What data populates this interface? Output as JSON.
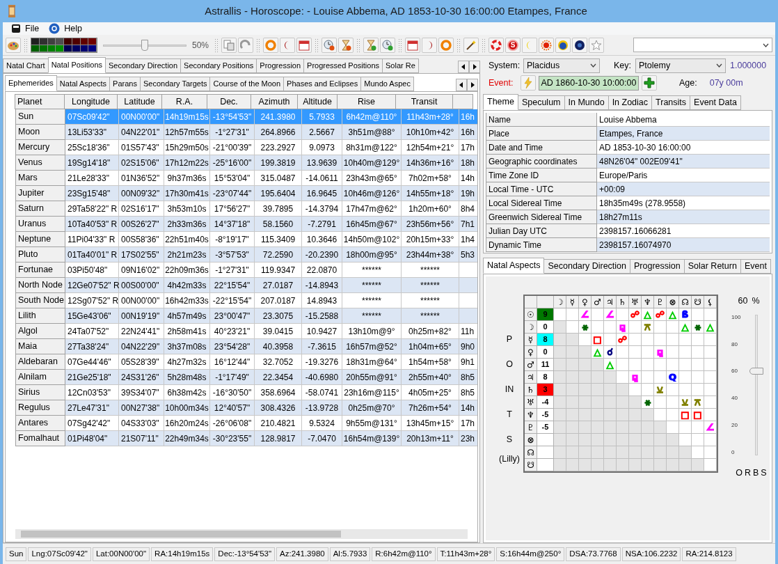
{
  "window": {
    "title": "Astrallis - Horoscope: - Louise Abbema, AD 1853-10-30 16:00:00 Etampes, France"
  },
  "menu": [
    "File",
    "Help"
  ],
  "toolbar": {
    "zoom": {
      "level": 0.5,
      "reading": "50%"
    },
    "badge_letter": "S"
  },
  "left": {
    "tabs": [
      {
        "label": "Natal Chart",
        "selected": false
      },
      {
        "label": "Natal Positions",
        "selected": true
      },
      {
        "label": "Secondary Direction",
        "selected": false
      },
      {
        "label": "Secondary Positions",
        "selected": false
      },
      {
        "label": "Progression",
        "selected": false
      },
      {
        "label": "Progressed Positions",
        "selected": false
      },
      {
        "label": "Solar Re",
        "selected": false
      }
    ],
    "subtabs": [
      {
        "label": "Ephemerides",
        "selected": true
      },
      {
        "label": "Natal Aspects",
        "selected": false
      },
      {
        "label": "Parans",
        "selected": false
      },
      {
        "label": "Secondary Targets",
        "selected": false
      },
      {
        "label": "Course of the Moon",
        "selected": false
      },
      {
        "label": "Phases and Eclipses",
        "selected": false
      },
      {
        "label": "Mundo Aspec",
        "selected": false
      }
    ],
    "table": {
      "columns": [
        "Planet",
        "Longitude",
        "Latitude",
        "R.A.",
        "Dec.",
        "Azimuth",
        "Altitude",
        "Rise",
        "Transit"
      ],
      "rows": [
        {
          "planet": "Sun",
          "selected": true,
          "values": [
            "07Sc09'42\"",
            "00N00'00\"",
            "14h19m15s",
            "-13°54'53\"",
            "241.3980",
            "5.7933",
            "6h42m@110°",
            "11h43m+28°"
          ],
          "column_10": "16h"
        },
        {
          "planet": "Moon",
          "selected": false,
          "values": [
            "13Li53'33\"",
            "04N22'01\"",
            "12h57m55s",
            "-1°27'31\"",
            "264.8966",
            "2.5667",
            "3h51m@88°",
            "10h10m+42°"
          ],
          "column_10": "16h"
        },
        {
          "planet": "Mercury",
          "selected": false,
          "values": [
            "25Sc18'36\"",
            "01S57'43\"",
            "15h29m50s",
            "-21°00'39\"",
            "223.2927",
            "9.0973",
            "8h31m@122°",
            "12h54m+21°"
          ],
          "column_10": "17h"
        },
        {
          "planet": "Venus",
          "selected": false,
          "values": [
            "19Sg14'18\"",
            "02S15'06\"",
            "17h12m22s",
            "-25°16'00\"",
            "199.3819",
            "13.9639",
            "10h40m@129°",
            "14h36m+16°"
          ],
          "column_10": "18h"
        },
        {
          "planet": "Mars",
          "selected": false,
          "values": [
            "21Le28'33\"",
            "01N36'52\"",
            "9h37m36s",
            "15°53'04\"",
            "315.0487",
            "-14.0611",
            "23h43m@65°",
            "7h02m+58°"
          ],
          "column_10": "14h"
        },
        {
          "planet": "Jupiter",
          "selected": false,
          "values": [
            "23Sg15'48\"",
            "00N09'32\"",
            "17h30m41s",
            "-23°07'44\"",
            "195.6404",
            "16.9645",
            "10h46m@126°",
            "14h55m+18°"
          ],
          "column_10": "19h"
        },
        {
          "planet": "Saturn",
          "selected": false,
          "values": [
            "29Ta58'22\" R",
            "02S16'17\"",
            "3h53m10s",
            "17°56'27\"",
            "39.7895",
            "-14.3794",
            "17h47m@62°",
            "1h20m+60°"
          ],
          "column_10": "8h4"
        },
        {
          "planet": "Uranus",
          "selected": false,
          "values": [
            "10Ta40'53\" R",
            "00S26'27\"",
            "2h33m36s",
            "14°37'18\"",
            "58.1560",
            "-7.2791",
            "16h45m@67°",
            "23h56m+56°"
          ],
          "column_10": "7h1"
        },
        {
          "planet": "Neptune",
          "selected": false,
          "values": [
            "11Pi04'33\" R",
            "00S58'36\"",
            "22h51m40s",
            "-8°19'17\"",
            "115.3409",
            "10.3646",
            "14h50m@102°",
            "20h15m+33°"
          ],
          "column_10": "1h4"
        },
        {
          "planet": "Pluto",
          "selected": false,
          "values": [
            "01Ta40'01\" R",
            "17S02'55\"",
            "2h21m23s",
            "-3°57'53\"",
            "72.2590",
            "-20.2390",
            "18h00m@95°",
            "23h44m+38°"
          ],
          "column_10": "5h3"
        },
        {
          "planet": "Fortunae",
          "selected": false,
          "values": [
            "03Pi50'48\"",
            "09N16'02\"",
            "22h09m36s",
            "-1°27'31\"",
            "119.9347",
            "22.0870",
            "******",
            "******"
          ]
        },
        {
          "planet": "North Node",
          "selected": false,
          "values": [
            "12Ge07'52\" R",
            "00S00'00\"",
            "4h42m33s",
            "22°15'54\"",
            "27.0187",
            "-14.8943",
            "******",
            "******"
          ]
        },
        {
          "planet": "South Node",
          "selected": false,
          "values": [
            "12Sg07'52\" R",
            "00N00'00\"",
            "16h42m33s",
            "-22°15'54\"",
            "207.0187",
            "14.8943",
            "******",
            "******"
          ]
        },
        {
          "planet": "Lilith",
          "selected": false,
          "values": [
            "15Ge43'06\"",
            "00N19'19\"",
            "4h57m49s",
            "23°00'47\"",
            "23.3075",
            "-15.2588",
            "******",
            "******"
          ]
        },
        {
          "planet": "Algol",
          "selected": false,
          "values": [
            "24Ta07'52\"",
            "22N24'41\"",
            "2h58m41s",
            "40°23'21\"",
            "39.0415",
            "10.9427",
            "13h10m@9°",
            "0h25m+82°"
          ],
          "column_10": "11h"
        },
        {
          "planet": "Maia",
          "selected": false,
          "values": [
            "27Ta38'24\"",
            "04N22'29\"",
            "3h37m08s",
            "23°54'28\"",
            "40.3958",
            "-7.3615",
            "16h57m@52°",
            "1h04m+65°"
          ],
          "column_10": "9h0"
        },
        {
          "planet": "Aldebaran",
          "selected": false,
          "values": [
            "07Ge44'46\"",
            "05S28'39\"",
            "4h27m32s",
            "16°12'44\"",
            "32.7052",
            "-19.3276",
            "18h31m@64°",
            "1h54m+58°"
          ],
          "column_10": "9h1"
        },
        {
          "planet": "Alnilam",
          "selected": false,
          "values": [
            "21Ge25'18\"",
            "24S31'26\"",
            "5h28m48s",
            "-1°17'49\"",
            "22.3454",
            "-40.6980",
            "20h55m@91°",
            "2h55m+40°"
          ],
          "column_10": "8h5"
        },
        {
          "planet": "Sirius",
          "selected": false,
          "values": [
            "12Cn03'53\"",
            "39S34'07\"",
            "6h38m42s",
            "-16°30'50\"",
            "358.6964",
            "-58.0741",
            "23h16m@115°",
            "4h05m+25°"
          ],
          "column_10": "8h5"
        },
        {
          "planet": "Regulus",
          "selected": false,
          "values": [
            "27Le47'31\"",
            "00N27'38\"",
            "10h00m34s",
            "12°40'57\"",
            "308.4326",
            "-13.9728",
            "0h25m@70°",
            "7h26m+54°"
          ],
          "column_10": "14h"
        },
        {
          "planet": "Antares",
          "selected": false,
          "values": [
            "07Sg42'42\"",
            "04S33'03\"",
            "16h20m24s",
            "-26°06'08\"",
            "210.4821",
            "9.5324",
            "9h55m@131°",
            "13h45m+15°"
          ],
          "column_10": "17h"
        },
        {
          "planet": "Fomalhaut",
          "selected": false,
          "values": [
            "01Pi48'04\"",
            "21S07'11\"",
            "22h49m34s",
            "-30°23'55\"",
            "128.9817",
            "-7.0470",
            "16h54m@139°",
            "20h13m+11°"
          ],
          "column_10": "23h"
        }
      ]
    }
  },
  "right": {
    "system": {
      "label": "System:",
      "value": "Placidus"
    },
    "key": {
      "label": "Key:",
      "value": "Ptolemy",
      "reading": "1.000000"
    },
    "event": {
      "label": "Event:",
      "value": "AD 1860-10-30 10:00:00"
    },
    "age": {
      "label": "Age:",
      "value": "07y 00m"
    },
    "tabs": [
      {
        "label": "Theme",
        "selected": true
      },
      {
        "label": "Speculum",
        "selected": false
      },
      {
        "label": "In Mundo",
        "selected": false
      },
      {
        "label": "In Zodiac",
        "selected": false
      },
      {
        "label": "Transits",
        "selected": false
      },
      {
        "label": "Event Data",
        "selected": false
      }
    ],
    "theme": [
      {
        "label": "Name",
        "value": "Louise Abbema"
      },
      {
        "label": "Place",
        "value": "Etampes, France"
      },
      {
        "label": "Date and Time",
        "value": "AD 1853-10-30 16:00:00"
      },
      {
        "label": "Geographic coordinates",
        "value": "48N26'04\" 002E09'41\""
      },
      {
        "label": "Time Zone ID",
        "value": "Europe/Paris"
      },
      {
        "label": "Local Time - UTC",
        "value": "+00:09"
      },
      {
        "label": "Local Sidereal Time",
        "value": "18h35m49s (278.9558)"
      },
      {
        "label": "Greenwich Sidereal Time",
        "value": "18h27m11s"
      },
      {
        "label": "Julian Day UTC",
        "value": "2398157.16066281"
      },
      {
        "label": "Dynamic Time",
        "value": "2398157.16074970"
      }
    ],
    "bottom_tabs": [
      {
        "label": "Natal Aspects",
        "selected": true
      },
      {
        "label": "Secondary Direction",
        "selected": false
      },
      {
        "label": "Progression",
        "selected": false
      },
      {
        "label": "Solar Return",
        "selected": false
      },
      {
        "label": "Event",
        "selected": false
      }
    ],
    "aspects": {
      "side_label": "POINTS",
      "side_note": "(Lilly)",
      "columns": [
        "☽",
        "☿",
        "♀",
        "♂",
        "♃",
        "♄",
        "♅",
        "♆",
        "♇",
        "⊗",
        "☊",
        "☋",
        "⚸"
      ],
      "rows": [
        {
          "point": "☉",
          "score": "9",
          "color": "#007800",
          "cells": [
            {
              "kind": "empty"
            },
            {
              "kind": "empty"
            },
            {
              "kind": "aspect",
              "glyph": "∠",
              "color": "#ff00ff"
            },
            {
              "kind": "empty"
            },
            {
              "kind": "aspect",
              "glyph": "∠",
              "color": "#ff00ff"
            },
            {
              "kind": "empty"
            },
            {
              "kind": "aspect",
              "glyph": "☍",
              "color": "#ff0000"
            },
            {
              "kind": "aspect",
              "glyph": "△",
              "color": "#00cc00"
            },
            {
              "kind": "aspect",
              "glyph": "☍",
              "color": "#ff0000"
            },
            {
              "kind": "aspect",
              "glyph": "△",
              "color": "#00cc00"
            },
            {
              "kind": "aspect",
              "glyph": "ß",
              "color": "#0000ff"
            },
            {
              "kind": "empty"
            },
            {
              "kind": "empty"
            }
          ]
        },
        {
          "point": "☽",
          "score": "0",
          "cells": [
            {
              "kind": "empty"
            },
            {
              "kind": "empty"
            },
            {
              "kind": "aspect",
              "glyph": "⚹",
              "color": "#006400"
            },
            {
              "kind": "empty"
            },
            {
              "kind": "empty"
            },
            {
              "kind": "aspect",
              "glyph": "⚼",
              "color": "#ff00ff"
            },
            {
              "kind": "empty"
            },
            {
              "kind": "aspect",
              "glyph": "⚻",
              "color": "#808000"
            },
            {
              "kind": "empty"
            },
            {
              "kind": "empty"
            },
            {
              "kind": "aspect",
              "glyph": "△",
              "color": "#00cc00"
            },
            {
              "kind": "aspect",
              "glyph": "⚹",
              "color": "#006400"
            },
            {
              "kind": "aspect",
              "glyph": "△",
              "color": "#00cc00"
            }
          ]
        },
        {
          "point": "☿",
          "score": "8",
          "color": "#00ffff",
          "cells": [
            {
              "kind": "empty"
            },
            {
              "kind": "empty"
            },
            {
              "kind": "empty"
            },
            {
              "kind": "aspect",
              "glyph": "□",
              "color": "#ff0000"
            },
            {
              "kind": "empty"
            },
            {
              "kind": "aspect",
              "glyph": "☍",
              "color": "#ff0000"
            },
            {
              "kind": "empty"
            },
            {
              "kind": "empty"
            },
            {
              "kind": "empty"
            },
            {
              "kind": "empty"
            },
            {
              "kind": "empty"
            },
            {
              "kind": "empty"
            },
            {
              "kind": "empty"
            }
          ]
        },
        {
          "point": "♀",
          "score": "0",
          "cells": [
            {
              "kind": "empty"
            },
            {
              "kind": "empty"
            },
            {
              "kind": "empty"
            },
            {
              "kind": "aspect",
              "glyph": "△",
              "color": "#00cc00"
            },
            {
              "kind": "aspect",
              "glyph": "☌",
              "color": "#000080"
            },
            {
              "kind": "empty"
            },
            {
              "kind": "empty"
            },
            {
              "kind": "empty"
            },
            {
              "kind": "aspect",
              "glyph": "⚼",
              "color": "#ff00ff"
            },
            {
              "kind": "empty"
            },
            {
              "kind": "empty"
            },
            {
              "kind": "empty"
            },
            {
              "kind": "empty"
            }
          ]
        },
        {
          "point": "♂",
          "score": "11",
          "cells": [
            {
              "kind": "empty"
            },
            {
              "kind": "empty"
            },
            {
              "kind": "empty"
            },
            {
              "kind": "empty"
            },
            {
              "kind": "aspect",
              "glyph": "△",
              "color": "#00cc00"
            },
            {
              "kind": "empty"
            },
            {
              "kind": "empty"
            },
            {
              "kind": "empty"
            },
            {
              "kind": "empty"
            },
            {
              "kind": "empty"
            },
            {
              "kind": "empty"
            },
            {
              "kind": "empty"
            },
            {
              "kind": "empty"
            }
          ]
        },
        {
          "point": "♃",
          "score": "8",
          "cells": [
            {
              "kind": "empty"
            },
            {
              "kind": "empty"
            },
            {
              "kind": "empty"
            },
            {
              "kind": "empty"
            },
            {
              "kind": "empty"
            },
            {
              "kind": "empty"
            },
            {
              "kind": "aspect",
              "glyph": "⚼",
              "color": "#ff00ff"
            },
            {
              "kind": "empty"
            },
            {
              "kind": "empty"
            },
            {
              "kind": "aspect",
              "glyph": "Q",
              "color": "#0000ff"
            },
            {
              "kind": "empty"
            },
            {
              "kind": "empty"
            },
            {
              "kind": "empty"
            }
          ]
        },
        {
          "point": "♄",
          "score": "3",
          "color": "#ff0000",
          "cells": [
            {
              "kind": "empty"
            },
            {
              "kind": "empty"
            },
            {
              "kind": "empty"
            },
            {
              "kind": "empty"
            },
            {
              "kind": "empty"
            },
            {
              "kind": "empty"
            },
            {
              "kind": "empty"
            },
            {
              "kind": "empty"
            },
            {
              "kind": "aspect",
              "glyph": "⚺",
              "color": "#808000"
            },
            {
              "kind": "empty"
            },
            {
              "kind": "empty"
            },
            {
              "kind": "empty"
            },
            {
              "kind": "empty"
            }
          ]
        },
        {
          "point": "♅",
          "score": "-4",
          "cells": [
            {
              "kind": "empty"
            },
            {
              "kind": "empty"
            },
            {
              "kind": "empty"
            },
            {
              "kind": "empty"
            },
            {
              "kind": "empty"
            },
            {
              "kind": "empty"
            },
            {
              "kind": "empty"
            },
            {
              "kind": "aspect",
              "glyph": "⚹",
              "color": "#006400"
            },
            {
              "kind": "empty"
            },
            {
              "kind": "empty"
            },
            {
              "kind": "aspect",
              "glyph": "⚺",
              "color": "#808000"
            },
            {
              "kind": "aspect",
              "glyph": "⚻",
              "color": "#808000"
            },
            {
              "kind": "empty"
            }
          ]
        },
        {
          "point": "♆",
          "score": "-5",
          "cells": [
            {
              "kind": "empty"
            },
            {
              "kind": "empty"
            },
            {
              "kind": "empty"
            },
            {
              "kind": "empty"
            },
            {
              "kind": "empty"
            },
            {
              "kind": "empty"
            },
            {
              "kind": "empty"
            },
            {
              "kind": "empty"
            },
            {
              "kind": "empty"
            },
            {
              "kind": "empty"
            },
            {
              "kind": "aspect",
              "glyph": "□",
              "color": "#ff0000"
            },
            {
              "kind": "aspect",
              "glyph": "□",
              "color": "#ff0000"
            },
            {
              "kind": "empty"
            }
          ]
        },
        {
          "point": "♇",
          "score": "-5",
          "cells": [
            {
              "kind": "empty"
            },
            {
              "kind": "empty"
            },
            {
              "kind": "empty"
            },
            {
              "kind": "empty"
            },
            {
              "kind": "empty"
            },
            {
              "kind": "empty"
            },
            {
              "kind": "empty"
            },
            {
              "kind": "empty"
            },
            {
              "kind": "empty"
            },
            {
              "kind": "empty"
            },
            {
              "kind": "empty"
            },
            {
              "kind": "empty"
            },
            {
              "kind": "aspect",
              "glyph": "∠",
              "color": "#ff00ff"
            }
          ]
        },
        {
          "point": "⊗",
          "cells": [
            {
              "kind": "empty"
            },
            {
              "kind": "empty"
            },
            {
              "kind": "empty"
            },
            {
              "kind": "empty"
            },
            {
              "kind": "empty"
            },
            {
              "kind": "empty"
            },
            {
              "kind": "empty"
            },
            {
              "kind": "empty"
            },
            {
              "kind": "empty"
            },
            {
              "kind": "empty"
            },
            {
              "kind": "empty"
            },
            {
              "kind": "empty"
            },
            {
              "kind": "empty"
            }
          ]
        },
        {
          "point": "☊",
          "cells": [
            {
              "kind": "empty"
            },
            {
              "kind": "empty"
            },
            {
              "kind": "empty"
            },
            {
              "kind": "empty"
            },
            {
              "kind": "empty"
            },
            {
              "kind": "empty"
            },
            {
              "kind": "empty"
            },
            {
              "kind": "empty"
            },
            {
              "kind": "empty"
            },
            {
              "kind": "empty"
            },
            {
              "kind": "empty"
            },
            {
              "kind": "empty"
            },
            {
              "kind": "empty"
            }
          ]
        },
        {
          "point": "☋",
          "cells": [
            {
              "kind": "empty"
            },
            {
              "kind": "empty"
            },
            {
              "kind": "empty"
            },
            {
              "kind": "empty"
            },
            {
              "kind": "empty"
            },
            {
              "kind": "empty"
            },
            {
              "kind": "empty"
            },
            {
              "kind": "empty"
            },
            {
              "kind": "empty"
            },
            {
              "kind": "empty"
            },
            {
              "kind": "empty"
            },
            {
              "kind": "empty"
            },
            {
              "kind": "empty"
            }
          ]
        }
      ]
    },
    "orbs": {
      "reading": "60",
      "unit": "%",
      "level": 0.6,
      "ticks": [
        "100",
        "80",
        "60",
        "40",
        "20",
        "0"
      ],
      "caption": "ORBS"
    }
  },
  "status_bar": [
    "Sun",
    "Lng:07Sc09'42\"",
    "Lat:00N00'00\"",
    "RA:14h19m15s",
    "Dec:-13°54'53\"",
    "Az:241.3980",
    "Al:5.7933",
    "R:6h42m@110°",
    "T:11h43m+28°",
    "S:16h44m@250°",
    "DSA:73.7768",
    "NSA:106.2232",
    "RA:214.8123"
  ]
}
